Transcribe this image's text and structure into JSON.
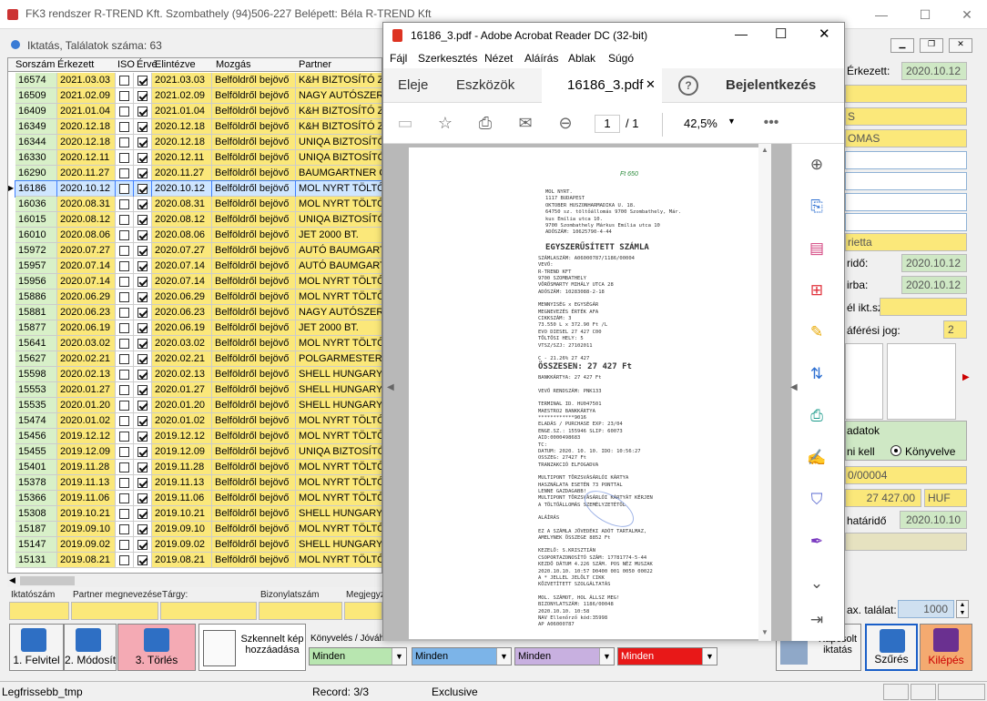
{
  "window": {
    "title": "FK3 rendszer R-TREND Kft. Szombathely (94)506-227 Belépett: Béla R-TREND Kft"
  },
  "subwindow": {
    "title": "Iktatás, Találatok száma: 63"
  },
  "grid": {
    "headers": [
      "Sorszám",
      "Érkezett",
      "ISO",
      "Érvé",
      "Elintézve",
      "Mozgás",
      "Partner"
    ],
    "rows": [
      [
        "16574",
        "2021.03.03",
        false,
        true,
        "2021.03.03",
        "Belföldről bejövő",
        "K&H BIZTOSÍTÓ Zr"
      ],
      [
        "16509",
        "2021.02.09",
        false,
        true,
        "2021.02.09",
        "Belföldről bejövő",
        "NAGY AUTÓSZER"
      ],
      [
        "16409",
        "2021.01.04",
        false,
        true,
        "2021.01.04",
        "Belföldről bejövő",
        "K&H BIZTOSÍTÓ Zr"
      ],
      [
        "16349",
        "2020.12.18",
        false,
        true,
        "2020.12.18",
        "Belföldről bejövő",
        "K&H BIZTOSÍTÓ Zr"
      ],
      [
        "16344",
        "2020.12.18",
        false,
        true,
        "2020.12.18",
        "Belföldről bejövő",
        "UNIQA BIZTOSÍTÓ"
      ],
      [
        "16330",
        "2020.12.11",
        false,
        true,
        "2020.12.11",
        "Belföldről bejövő",
        "UNIQA BIZTOSÍTÓ"
      ],
      [
        "16290",
        "2020.11.27",
        false,
        true,
        "2020.11.27",
        "Belföldről bejövő",
        "BAUMGARTNER G"
      ],
      [
        "16186",
        "2020.10.12",
        false,
        true,
        "2020.10.12",
        "Belföldről bejövő",
        "MOL NYRT TÖLTŐ"
      ],
      [
        "16036",
        "2020.08.31",
        false,
        true,
        "2020.08.31",
        "Belföldről bejövő",
        "MOL NYRT TÖLTŐ"
      ],
      [
        "16015",
        "2020.08.12",
        false,
        true,
        "2020.08.12",
        "Belföldről bejövő",
        "UNIQA BIZTOSÍTÓ"
      ],
      [
        "16010",
        "2020.08.06",
        false,
        true,
        "2020.08.06",
        "Belföldről bejövő",
        "JET 2000 BT."
      ],
      [
        "15972",
        "2020.07.27",
        false,
        true,
        "2020.07.27",
        "Belföldről bejövő",
        "AUTÓ BAUMGART"
      ],
      [
        "15957",
        "2020.07.14",
        false,
        true,
        "2020.07.14",
        "Belföldről bejövő",
        "AUTÓ BAUMGART"
      ],
      [
        "15956",
        "2020.07.14",
        false,
        true,
        "2020.07.14",
        "Belföldről bejövő",
        "MOL NYRT TÖLTŐ"
      ],
      [
        "15886",
        "2020.06.29",
        false,
        true,
        "2020.06.29",
        "Belföldről bejövő",
        "MOL NYRT TÖLTŐ"
      ],
      [
        "15881",
        "2020.06.23",
        false,
        true,
        "2020.06.23",
        "Belföldről bejövő",
        "NAGY AUTÓSZER"
      ],
      [
        "15877",
        "2020.06.19",
        false,
        true,
        "2020.06.19",
        "Belföldről bejövő",
        "JET 2000 BT."
      ],
      [
        "15641",
        "2020.03.02",
        false,
        true,
        "2020.03.02",
        "Belföldről bejövő",
        "MOL NYRT TÖLTŐ"
      ],
      [
        "15627",
        "2020.02.21",
        false,
        true,
        "2020.02.21",
        "Belföldről bejövő",
        "POLGARMESTERI"
      ],
      [
        "15598",
        "2020.02.13",
        false,
        true,
        "2020.02.13",
        "Belföldről bejövő",
        "SHELL HUNGARY"
      ],
      [
        "15553",
        "2020.01.27",
        false,
        true,
        "2020.01.27",
        "Belföldről bejövő",
        "SHELL HUNGARY"
      ],
      [
        "15535",
        "2020.01.20",
        false,
        true,
        "2020.01.20",
        "Belföldről bejövő",
        "SHELL HUNGARY"
      ],
      [
        "15474",
        "2020.01.02",
        false,
        true,
        "2020.01.02",
        "Belföldről bejövő",
        "MOL NYRT TÖLTŐ"
      ],
      [
        "15456",
        "2019.12.12",
        false,
        true,
        "2019.12.12",
        "Belföldről bejövő",
        "MOL NYRT TÖLTŐ"
      ],
      [
        "15455",
        "2019.12.09",
        false,
        true,
        "2019.12.09",
        "Belföldről bejövő",
        "UNIQA BIZTOSÍTÓ"
      ],
      [
        "15401",
        "2019.11.28",
        false,
        true,
        "2019.11.28",
        "Belföldről bejövő",
        "MOL NYRT TÖLTŐ"
      ],
      [
        "15378",
        "2019.11.13",
        false,
        true,
        "2019.11.13",
        "Belföldről bejövő",
        "MOL NYRT TÖLTŐ"
      ],
      [
        "15366",
        "2019.11.06",
        false,
        true,
        "2019.11.06",
        "Belföldről bejövő",
        "MOL NYRT TÖLTŐ"
      ],
      [
        "15308",
        "2019.10.21",
        false,
        true,
        "2019.10.21",
        "Belföldről bejövő",
        "SHELL HUNGARY"
      ],
      [
        "15187",
        "2019.09.10",
        false,
        true,
        "2019.09.10",
        "Belföldről bejövő",
        "MOL NYRT TÖLTŐ"
      ],
      [
        "15147",
        "2019.09.02",
        false,
        true,
        "2019.09.02",
        "Belföldről bejövő",
        "SHELL HUNGARY"
      ],
      [
        "15131",
        "2019.08.21",
        false,
        true,
        "2019.08.21",
        "Belföldről bejövő",
        "MOL NYRT TÖLTŐ"
      ]
    ],
    "selected_index": 7
  },
  "filters": {
    "labels": [
      "Iktatószám",
      "Partner megnevezése",
      "Tárgy:",
      "Bizonylatszám",
      "Megjegyz"
    ]
  },
  "buttons": {
    "felvitel": "1. Felvitel",
    "modosit": "2. Módosít",
    "torles": "3. Törlés",
    "szkennelt": "Szkennelt kép hozzáadása",
    "kapcsolt": "Kapcsolt iktatás",
    "szures": "Szűrés",
    "kilepes": "Kilépés"
  },
  "selectors": {
    "label": "Könyvelés / Jóváh",
    "values": [
      "Minden",
      "Minden",
      "Minden",
      "Minden"
    ]
  },
  "right_form": {
    "erkezett_label": "Érkezett:",
    "erkezett": "2020.10.12",
    "f3": "S",
    "f4": "OMAS",
    "f9": "rietta",
    "hatarido_label": "ridő:",
    "hatarido": "2020.10.12",
    "irba_label": "irba:",
    "irba": "2020.10.12",
    "ikt_label": "él ikt.sz.:",
    "hozzaferes_label": "áférési jog:",
    "hozzaferes": "2",
    "adatok_label": "adatok",
    "kell_label": "ni kell",
    "konyvelve_label": "Könyvelve",
    "szamla": "0/00004",
    "osszeg": "27 427.00",
    "penznem": "HUF",
    "fiz_label": "határidő",
    "fiz": "2020.10.10",
    "max_label": "ax. találat:",
    "max": "1000"
  },
  "acrobat": {
    "title": "16186_3.pdf - Adobe Acrobat Reader DC (32-bit)",
    "menu": [
      "Fájl",
      "Szerkesztés",
      "Nézet",
      "Aláírás",
      "Ablak",
      "Súgó"
    ],
    "tabs": {
      "home": "Eleje",
      "tools": "Eszközök",
      "doc": "16186_3.pdf",
      "login": "Bejelentkezés"
    },
    "page_current": "1",
    "page_sep": "/ 1",
    "zoom": "42,5%"
  },
  "receipt": {
    "lines": [
      "MOL NYRT.",
      "1117 BUDAPEST",
      "OKTOBER HUSZONHARMADIKA U. 18.",
      "64750 sz. töltőállomás 9700 Szombathely, Már.",
      "kus Emília utca 10.",
      "9700 Szombathely Márkus Emília utca 10",
      "ADÓSZÁM: 10625790-4-44",
      "EGYSZERŰSÍTETT SZÁMLA",
      "SZÁMLASZÁM:         A06000787/1186/00004",
      "VEVŐ:",
      "R-TREND KFT",
      "9700 SZOMBATHELY",
      "VÖRÖSMARTY MIHÁLY UTCA 28",
      "ADÓSZÁM: 10283088-2-18",
      "MENNYISÉG     x      EGYSÉGÁR",
      "MEGNEVEZÉS                  ÉRTÉK  AFA",
      "CIKKSZÁM: 3",
      "73.550 L    x        372.90 Ft /L",
      "EVO DIESEL                  27 427  C00",
      "TÖLTŐSI HELY:  5",
      "VTSZ/SZJ: 27102011",
      "C - 21.26%                  27 427",
      "ÖSSZESEN:     27 427 Ft",
      "BANKKÁRTYA:                 27 427 Ft",
      "VEVŐ RENDSZÁM: PNK133",
      "TERMINAL ID.                HU047501",
      "MAESTRO2                    BANKKÁRTYA",
      "************9016",
      "ELADÁS / PURCHASE     EXP:    23/04",
      "ENGE.SZ.: 155946      SLIP:   60073",
      "AID:0000498683",
      "TC:",
      "DATUM:   2020. 10. 10.   IDO: 10:56:27",
      "OSSZEG:                      27427 Ft",
      "TRANZAKCIÓ ELFOGADVA",
      "MULTIPONT TÖRZSVÁSÁRLÓI KÁRTYA",
      "HASZNÁLATA ESETÉN 73 PONTTAL",
      "LENNE GAZDAGABB!",
      "MULTIPONT TÖRZSVÁSÁRLÓI KÁRTYÁT KÉRJEN",
      "A TÖLTŐÁLLOMÁS SZEMÉLYZETÉTŐL",
      "ALÁÍRÁS",
      "EZ A SZÁMLA JÖVEDÉKI ADÓT TARTALMAZ,",
      "AMELYNEK ÖSSZEGE 8852 Ft",
      "KEZELŐ: S.KRISZTIÁN",
      "CSOPORTAZONOSÍTÓ SZÁM: 17781774-5-44",
      "KEZDŐ DÁTUM 4.226 SZÁM. POS NÉZ MUSZAK",
      "2020.10.10. 10:57 D0400 001 0050 00022",
      "A * JELLEL JELÖLT CIKK",
      "KÖZVETÍTETT SZOLGÁLTATÁS",
      "MOL. SZÁMOT, HOL ÁLLSZ MEG!",
      "BIZONYLATSZÁM:           1186/00048",
      "2020.10.10.                  10:58",
      "NAV Ellenőrző kód:35998",
      "AP A06000787"
    ],
    "handwritten": "Ft 650"
  },
  "status": {
    "left": "Legfrissebb_tmp",
    "record": "Record: 3/3",
    "mode": "Exclusive"
  }
}
